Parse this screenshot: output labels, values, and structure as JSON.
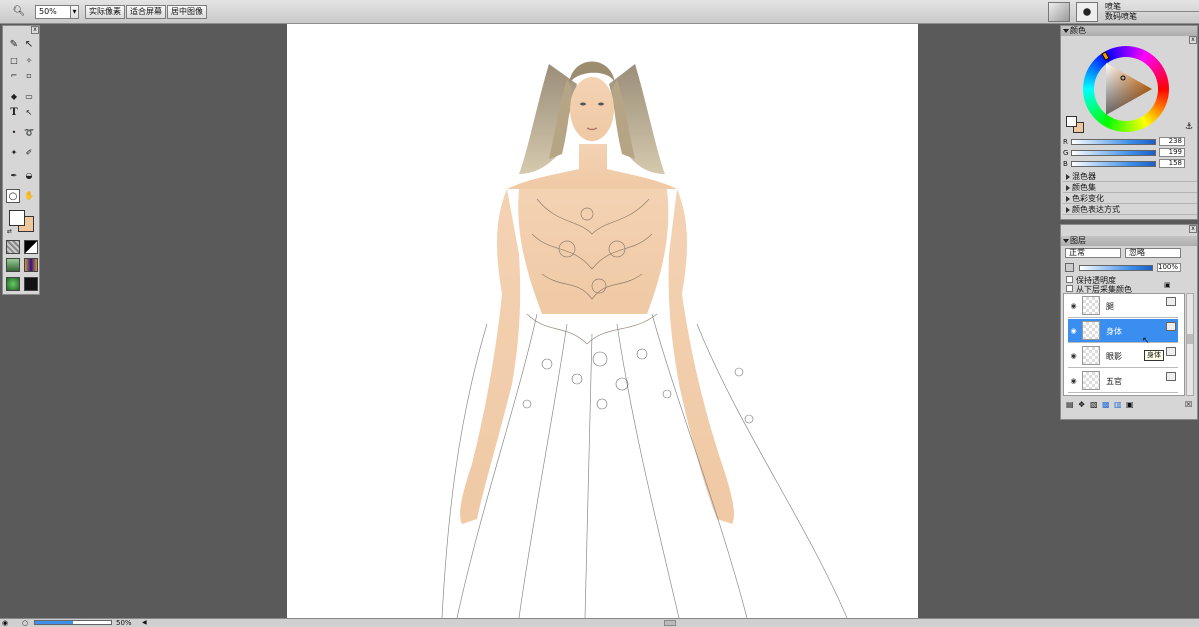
{
  "toolbar": {
    "zoom_value": "50%",
    "actual_pixels": "实际像素",
    "fit_screen": "适合屏幕",
    "center_image": "居中图像"
  },
  "brush": {
    "name": "喷笔",
    "sub": "数码喷笔"
  },
  "color_panel": {
    "title": "颜色",
    "r_label": "R",
    "r_value": "238",
    "g_label": "G",
    "g_value": "199",
    "b_label": "B",
    "b_value": "158",
    "foreground": "#eec79e",
    "sections": [
      "混色器",
      "颜色集",
      "色彩变化",
      "颜色表达方式"
    ]
  },
  "layers_panel": {
    "title": "图层",
    "blend_mode": "正常",
    "composite": "忽略",
    "opacity": "100%",
    "preserve_transparency": "保持透明度",
    "pick_up_color": "从下层采集颜色",
    "layers": [
      {
        "name": "腿",
        "selected": false
      },
      {
        "name": "身体",
        "selected": true
      },
      {
        "name": "眼影",
        "selected": false
      },
      {
        "name": "五官",
        "selected": false
      }
    ],
    "tooltip": "身体"
  },
  "status": {
    "zoom": "50%"
  },
  "colors": {
    "accent": "#3a8ef0",
    "workspace": "#5a5a5a",
    "skin": "#f1cfae"
  }
}
